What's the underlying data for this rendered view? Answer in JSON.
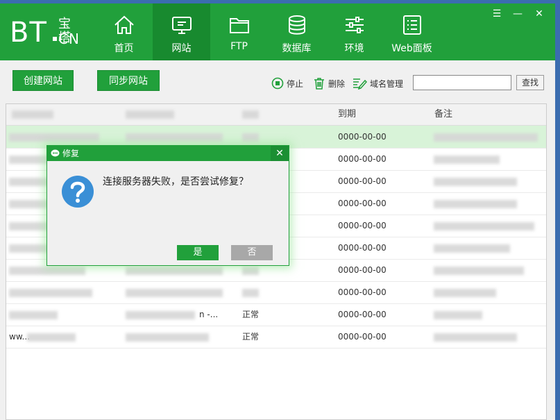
{
  "logo": {
    "text_bt": "BT",
    "text_cn_top": "宝塔",
    "text_cn_bottom": "CN"
  },
  "nav": [
    {
      "label": "首页",
      "icon": "home-icon"
    },
    {
      "label": "网站",
      "icon": "monitor-icon",
      "active": true
    },
    {
      "label": "FTP",
      "icon": "folder-icon"
    },
    {
      "label": "数据库",
      "icon": "database-icon"
    },
    {
      "label": "环境",
      "icon": "sliders-icon"
    },
    {
      "label": "Web面板",
      "icon": "list-icon"
    }
  ],
  "window_controls": {
    "menu": "☰",
    "minimize": "—",
    "close": "✕"
  },
  "toolbar": {
    "create_site": "创建网站",
    "sync_site": "同步网站",
    "stop": "停止",
    "delete": "删除",
    "domain_manage": "域名管理",
    "search_value": "",
    "search_button": "查找"
  },
  "table": {
    "headers": [
      "",
      "",
      "",
      "到期",
      "备注"
    ],
    "rows": [
      {
        "status": "",
        "expiry": "0000-00-00",
        "selected": true
      },
      {
        "status": "",
        "expiry": "0000-00-00"
      },
      {
        "status": "",
        "expiry": "0000-00-00"
      },
      {
        "status": "",
        "expiry": "0000-00-00"
      },
      {
        "status": "",
        "expiry": "0000-00-00"
      },
      {
        "status": "",
        "expiry": "0000-00-00"
      },
      {
        "status": "",
        "expiry": "0000-00-00"
      },
      {
        "status": "",
        "expiry": "0000-00-00"
      },
      {
        "status": "正常",
        "expiry": "0000-00-00",
        "path_tail": "n -..."
      },
      {
        "status": "正常",
        "expiry": "0000-00-00",
        "name_prefix": "ww..."
      }
    ]
  },
  "dialog": {
    "title": "修复",
    "message": "连接服务器失败，是否尝试修复？",
    "yes": "是",
    "no": "否",
    "close": "✕"
  },
  "colors": {
    "brand_green": "#21a03b",
    "active_green": "#188a2f",
    "selected_row": "#d8f3d8",
    "question_blue": "#3a8fd6"
  }
}
